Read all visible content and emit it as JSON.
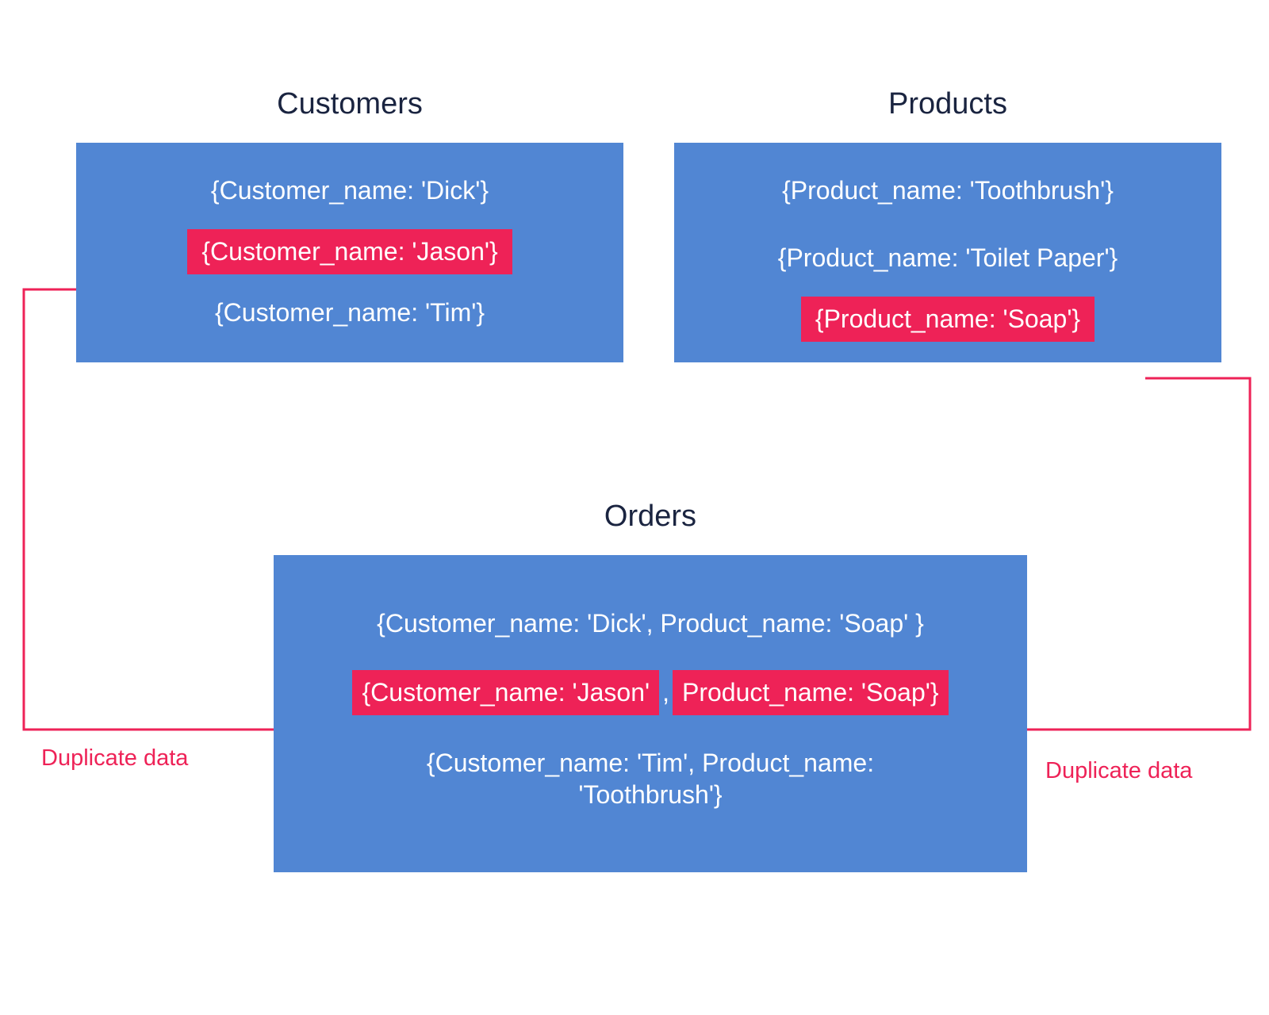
{
  "colors": {
    "box_bg": "#5186d3",
    "highlight": "#ee2257",
    "title": "#1a2440",
    "text": "#ffffff"
  },
  "customers": {
    "title": "Customers",
    "rows": [
      "{Customer_name: 'Dick'}",
      "{Customer_name: 'Jason'}",
      "{Customer_name: 'Tim'}"
    ],
    "highlight_index": 1
  },
  "products": {
    "title": "Products",
    "rows": [
      "{Product_name: 'Toothbrush'}",
      "{Product_name: 'Toilet Paper'}",
      "{Product_name: 'Soap'}"
    ],
    "highlight_index": 2
  },
  "orders": {
    "title": "Orders",
    "row1": "{Customer_name: 'Dick', Product_name: 'Soap' }",
    "row2_left": "{Customer_name: 'Jason'",
    "row2_sep": ",",
    "row2_right": "Product_name: 'Soap'}",
    "row3": "{Customer_name: 'Tim', Product_name: 'Toothbrush'}"
  },
  "labels": {
    "duplicate_left": "Duplicate data",
    "duplicate_right": "Duplicate data"
  }
}
